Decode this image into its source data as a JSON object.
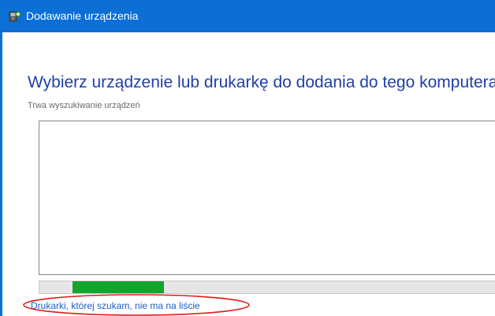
{
  "window": {
    "title": "Dodawanie urządzenia",
    "icon": "add-device-icon",
    "accent_color": "#0b6fd6"
  },
  "main": {
    "heading": "Wybierz urządzenie lub drukarkę do dodania do tego komputera",
    "status": "Trwa wyszukiwanie urządzeń",
    "device_list": [],
    "progress": {
      "state": "indeterminate",
      "color": "#12a52e"
    },
    "missing_printer_link": "Drukarki, której szukam, nie ma na liście"
  },
  "annotation": {
    "shape": "ellipse",
    "color": "#e01b1b"
  }
}
